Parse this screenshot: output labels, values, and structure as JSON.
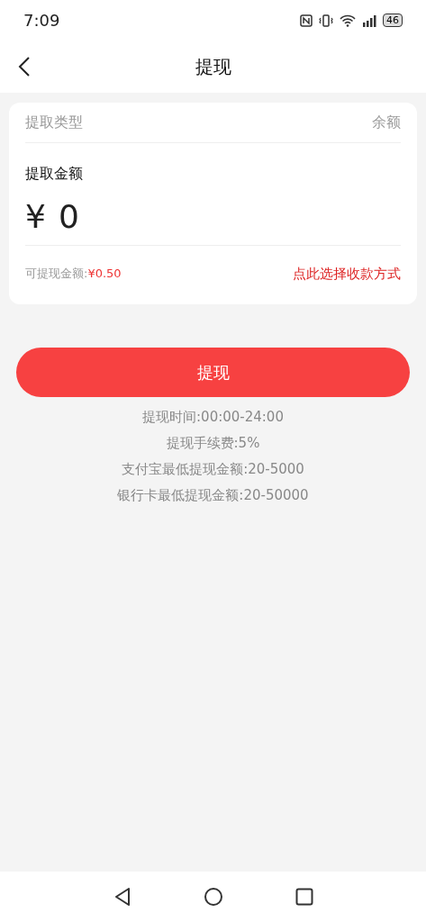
{
  "status_bar": {
    "time": "7:09",
    "battery": "46"
  },
  "header": {
    "title": "提现"
  },
  "card": {
    "type_label": "提取类型",
    "type_value": "余额",
    "amount_label": "提取金额",
    "currency": "¥",
    "amount_placeholder": "0",
    "available_label": "可提现金额:",
    "available_value": "¥0.50",
    "choose_method_link": "点此选择收款方式"
  },
  "submit_button": "提现",
  "notes": [
    "提现时间:00:00-24:00",
    "提现手续费:5%",
    "支付宝最低提现金额:20-5000",
    "银行卡最低提现金额:20-50000"
  ]
}
